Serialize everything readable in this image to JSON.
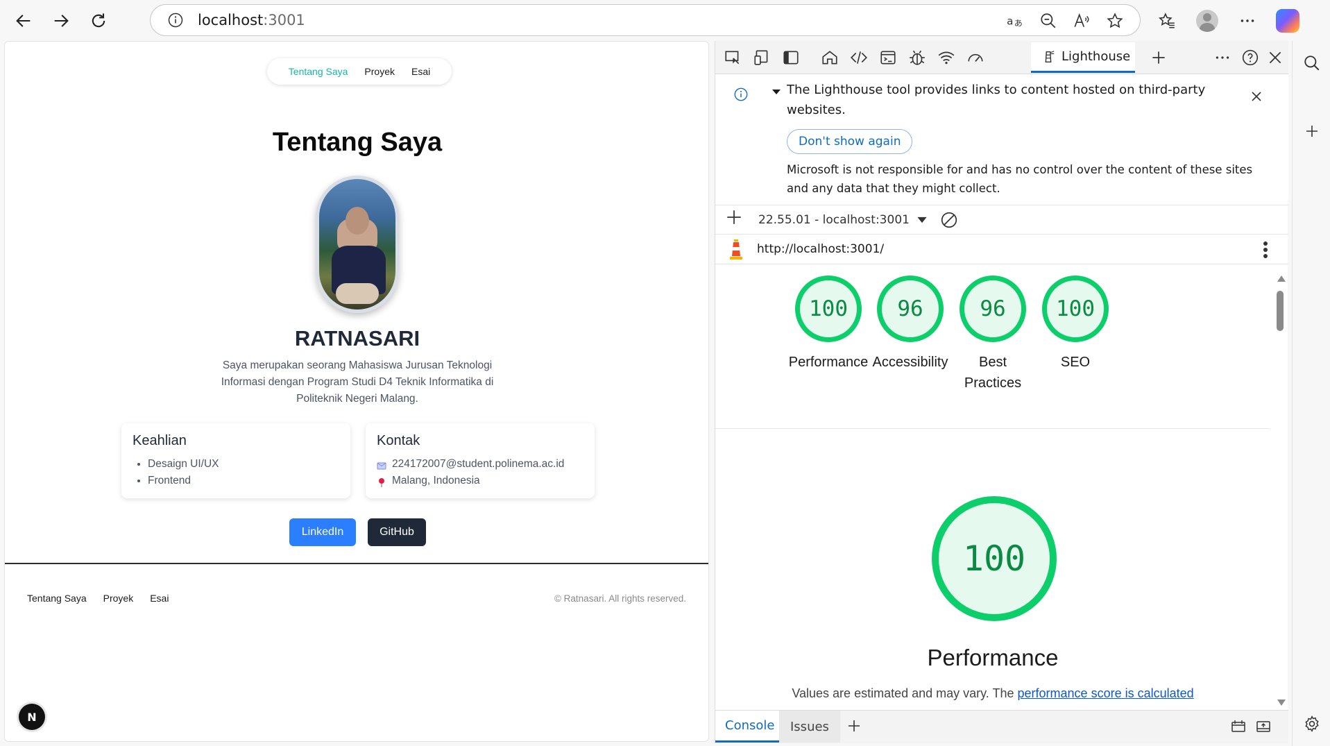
{
  "browser": {
    "url_host": "localhost",
    "url_port": ":3001"
  },
  "page": {
    "nav": [
      "Tentang Saya",
      "Proyek",
      "Esai"
    ],
    "title": "Tentang Saya",
    "name": "RATNASARI",
    "bio": "Saya merupakan seorang Mahasiswa Jurusan Teknologi Informasi dengan Program Studi D4 Teknik Informatika di Politeknik Negeri Malang.",
    "skills_title": "Keahlian",
    "skills": [
      "Desaign UI/UX",
      "Frontend"
    ],
    "contact_title": "Kontak",
    "contact_email": "224172007@student.polinema.ac.id",
    "contact_location": "Malang, Indonesia",
    "linkedin_label": "LinkedIn",
    "github_label": "GitHub",
    "footer_links": [
      "Tentang Saya",
      "Proyek",
      "Esai"
    ],
    "copyright": "© Ratnasari. All rights reserved.",
    "next_badge": "N",
    "colors": {
      "accent": "#14b8a6",
      "linkedin": "#2b7fff",
      "github": "#1f2937"
    }
  },
  "devtools": {
    "active_tab": "Lighthouse",
    "banner_text": "The Lighthouse tool provides links to content hosted on third-party websites.",
    "dont_show_again": "Don't show again",
    "banner_body": "Microsoft is not responsible for and has no control over the content of these sites and any data that they might collect.",
    "report_label": "22.55.01 - localhost:3001",
    "report_url": "http://localhost:3001/",
    "scores": [
      {
        "value": "100",
        "label": "Performance"
      },
      {
        "value": "96",
        "label": "Accessibility"
      },
      {
        "value": "96",
        "label": "Best Practices"
      },
      {
        "value": "100",
        "label": "SEO"
      }
    ],
    "big_score": "100",
    "big_label": "Performance",
    "note_prefix": "Values are estimated and may vary. The ",
    "note_link": "performance score is calculated",
    "drawer_tabs": [
      "Console",
      "Issues"
    ],
    "colors": {
      "pass": "#0cce6b",
      "pass_text": "#0b8a43",
      "link": "#0b57d0"
    }
  }
}
